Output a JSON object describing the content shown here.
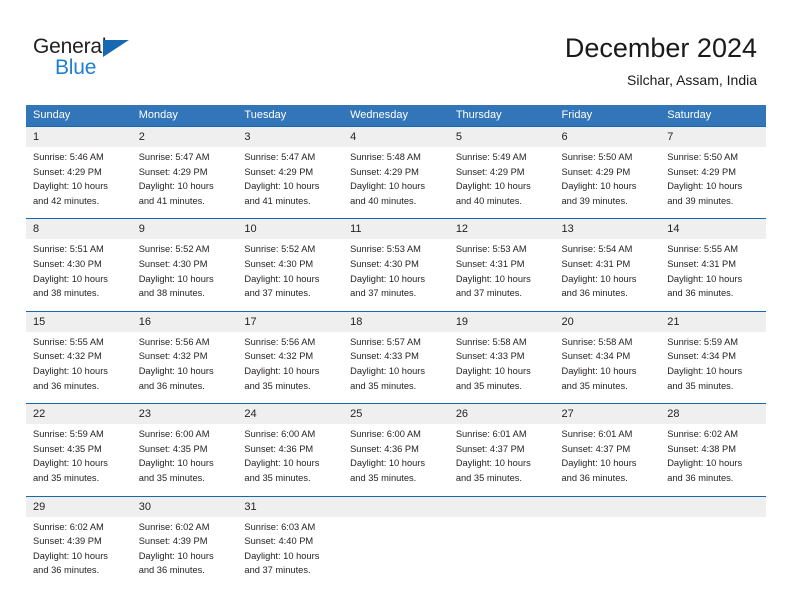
{
  "brand": {
    "name_top": "General",
    "name_bottom": "Blue"
  },
  "header": {
    "month_title": "December 2024",
    "location": "Silchar, Assam, India"
  },
  "theme": {
    "header_blue": "#3275b8",
    "row_rule_blue": "#1668b3",
    "daynum_bg": "#efefef",
    "logo_blue": "#1f7fd0",
    "text": "#231f20"
  },
  "weekday_headers": [
    "Sunday",
    "Monday",
    "Tuesday",
    "Wednesday",
    "Thursday",
    "Friday",
    "Saturday"
  ],
  "weeks": [
    [
      {
        "day": "1",
        "sunrise": "Sunrise: 5:46 AM",
        "sunset": "Sunset: 4:29 PM",
        "daylight1": "Daylight: 10 hours",
        "daylight2": "and 42 minutes."
      },
      {
        "day": "2",
        "sunrise": "Sunrise: 5:47 AM",
        "sunset": "Sunset: 4:29 PM",
        "daylight1": "Daylight: 10 hours",
        "daylight2": "and 41 minutes."
      },
      {
        "day": "3",
        "sunrise": "Sunrise: 5:47 AM",
        "sunset": "Sunset: 4:29 PM",
        "daylight1": "Daylight: 10 hours",
        "daylight2": "and 41 minutes."
      },
      {
        "day": "4",
        "sunrise": "Sunrise: 5:48 AM",
        "sunset": "Sunset: 4:29 PM",
        "daylight1": "Daylight: 10 hours",
        "daylight2": "and 40 minutes."
      },
      {
        "day": "5",
        "sunrise": "Sunrise: 5:49 AM",
        "sunset": "Sunset: 4:29 PM",
        "daylight1": "Daylight: 10 hours",
        "daylight2": "and 40 minutes."
      },
      {
        "day": "6",
        "sunrise": "Sunrise: 5:50 AM",
        "sunset": "Sunset: 4:29 PM",
        "daylight1": "Daylight: 10 hours",
        "daylight2": "and 39 minutes."
      },
      {
        "day": "7",
        "sunrise": "Sunrise: 5:50 AM",
        "sunset": "Sunset: 4:29 PM",
        "daylight1": "Daylight: 10 hours",
        "daylight2": "and 39 minutes."
      }
    ],
    [
      {
        "day": "8",
        "sunrise": "Sunrise: 5:51 AM",
        "sunset": "Sunset: 4:30 PM",
        "daylight1": "Daylight: 10 hours",
        "daylight2": "and 38 minutes."
      },
      {
        "day": "9",
        "sunrise": "Sunrise: 5:52 AM",
        "sunset": "Sunset: 4:30 PM",
        "daylight1": "Daylight: 10 hours",
        "daylight2": "and 38 minutes."
      },
      {
        "day": "10",
        "sunrise": "Sunrise: 5:52 AM",
        "sunset": "Sunset: 4:30 PM",
        "daylight1": "Daylight: 10 hours",
        "daylight2": "and 37 minutes."
      },
      {
        "day": "11",
        "sunrise": "Sunrise: 5:53 AM",
        "sunset": "Sunset: 4:30 PM",
        "daylight1": "Daylight: 10 hours",
        "daylight2": "and 37 minutes."
      },
      {
        "day": "12",
        "sunrise": "Sunrise: 5:53 AM",
        "sunset": "Sunset: 4:31 PM",
        "daylight1": "Daylight: 10 hours",
        "daylight2": "and 37 minutes."
      },
      {
        "day": "13",
        "sunrise": "Sunrise: 5:54 AM",
        "sunset": "Sunset: 4:31 PM",
        "daylight1": "Daylight: 10 hours",
        "daylight2": "and 36 minutes."
      },
      {
        "day": "14",
        "sunrise": "Sunrise: 5:55 AM",
        "sunset": "Sunset: 4:31 PM",
        "daylight1": "Daylight: 10 hours",
        "daylight2": "and 36 minutes."
      }
    ],
    [
      {
        "day": "15",
        "sunrise": "Sunrise: 5:55 AM",
        "sunset": "Sunset: 4:32 PM",
        "daylight1": "Daylight: 10 hours",
        "daylight2": "and 36 minutes."
      },
      {
        "day": "16",
        "sunrise": "Sunrise: 5:56 AM",
        "sunset": "Sunset: 4:32 PM",
        "daylight1": "Daylight: 10 hours",
        "daylight2": "and 36 minutes."
      },
      {
        "day": "17",
        "sunrise": "Sunrise: 5:56 AM",
        "sunset": "Sunset: 4:32 PM",
        "daylight1": "Daylight: 10 hours",
        "daylight2": "and 35 minutes."
      },
      {
        "day": "18",
        "sunrise": "Sunrise: 5:57 AM",
        "sunset": "Sunset: 4:33 PM",
        "daylight1": "Daylight: 10 hours",
        "daylight2": "and 35 minutes."
      },
      {
        "day": "19",
        "sunrise": "Sunrise: 5:58 AM",
        "sunset": "Sunset: 4:33 PM",
        "daylight1": "Daylight: 10 hours",
        "daylight2": "and 35 minutes."
      },
      {
        "day": "20",
        "sunrise": "Sunrise: 5:58 AM",
        "sunset": "Sunset: 4:34 PM",
        "daylight1": "Daylight: 10 hours",
        "daylight2": "and 35 minutes."
      },
      {
        "day": "21",
        "sunrise": "Sunrise: 5:59 AM",
        "sunset": "Sunset: 4:34 PM",
        "daylight1": "Daylight: 10 hours",
        "daylight2": "and 35 minutes."
      }
    ],
    [
      {
        "day": "22",
        "sunrise": "Sunrise: 5:59 AM",
        "sunset": "Sunset: 4:35 PM",
        "daylight1": "Daylight: 10 hours",
        "daylight2": "and 35 minutes."
      },
      {
        "day": "23",
        "sunrise": "Sunrise: 6:00 AM",
        "sunset": "Sunset: 4:35 PM",
        "daylight1": "Daylight: 10 hours",
        "daylight2": "and 35 minutes."
      },
      {
        "day": "24",
        "sunrise": "Sunrise: 6:00 AM",
        "sunset": "Sunset: 4:36 PM",
        "daylight1": "Daylight: 10 hours",
        "daylight2": "and 35 minutes."
      },
      {
        "day": "25",
        "sunrise": "Sunrise: 6:00 AM",
        "sunset": "Sunset: 4:36 PM",
        "daylight1": "Daylight: 10 hours",
        "daylight2": "and 35 minutes."
      },
      {
        "day": "26",
        "sunrise": "Sunrise: 6:01 AM",
        "sunset": "Sunset: 4:37 PM",
        "daylight1": "Daylight: 10 hours",
        "daylight2": "and 35 minutes."
      },
      {
        "day": "27",
        "sunrise": "Sunrise: 6:01 AM",
        "sunset": "Sunset: 4:37 PM",
        "daylight1": "Daylight: 10 hours",
        "daylight2": "and 36 minutes."
      },
      {
        "day": "28",
        "sunrise": "Sunrise: 6:02 AM",
        "sunset": "Sunset: 4:38 PM",
        "daylight1": "Daylight: 10 hours",
        "daylight2": "and 36 minutes."
      }
    ],
    [
      {
        "day": "29",
        "sunrise": "Sunrise: 6:02 AM",
        "sunset": "Sunset: 4:39 PM",
        "daylight1": "Daylight: 10 hours",
        "daylight2": "and 36 minutes."
      },
      {
        "day": "30",
        "sunrise": "Sunrise: 6:02 AM",
        "sunset": "Sunset: 4:39 PM",
        "daylight1": "Daylight: 10 hours",
        "daylight2": "and 36 minutes."
      },
      {
        "day": "31",
        "sunrise": "Sunrise: 6:03 AM",
        "sunset": "Sunset: 4:40 PM",
        "daylight1": "Daylight: 10 hours",
        "daylight2": "and 37 minutes."
      },
      {
        "day": "",
        "sunrise": "",
        "sunset": "",
        "daylight1": "",
        "daylight2": ""
      },
      {
        "day": "",
        "sunrise": "",
        "sunset": "",
        "daylight1": "",
        "daylight2": ""
      },
      {
        "day": "",
        "sunrise": "",
        "sunset": "",
        "daylight1": "",
        "daylight2": ""
      },
      {
        "day": "",
        "sunrise": "",
        "sunset": "",
        "daylight1": "",
        "daylight2": ""
      }
    ]
  ]
}
